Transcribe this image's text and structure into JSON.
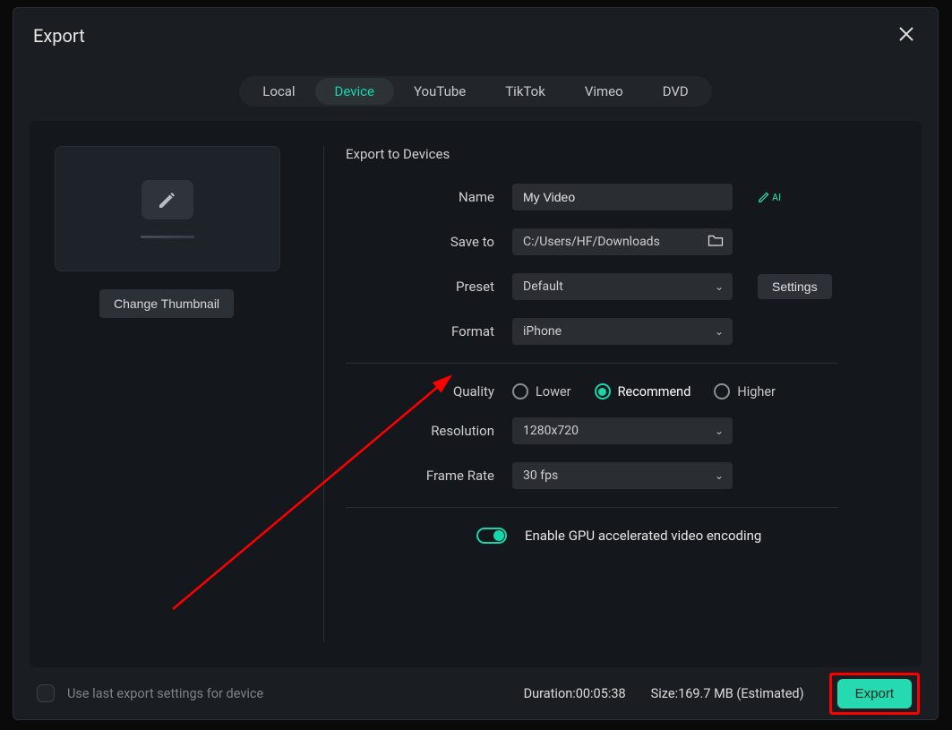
{
  "title": "Export",
  "tabs": [
    {
      "label": "Local"
    },
    {
      "label": "Device"
    },
    {
      "label": "YouTube"
    },
    {
      "label": "TikTok"
    },
    {
      "label": "Vimeo"
    },
    {
      "label": "DVD"
    }
  ],
  "active_tab": "Device",
  "change_thumbnail": "Change Thumbnail",
  "section_title": "Export to Devices",
  "labels": {
    "name": "Name",
    "save_to": "Save to",
    "preset": "Preset",
    "format": "Format",
    "quality": "Quality",
    "resolution": "Resolution",
    "frame_rate": "Frame Rate"
  },
  "values": {
    "name": "My Video",
    "save_to": "C:/Users/HF/Downloads",
    "preset": "Default",
    "format": "iPhone",
    "resolution": "1280x720",
    "frame_rate": "30 fps"
  },
  "ai_label": "AI",
  "settings_btn": "Settings",
  "quality_options": {
    "lower": "Lower",
    "recommend": "Recommend",
    "higher": "Higher"
  },
  "toggle_label": "Enable GPU accelerated video encoding",
  "footer": {
    "checkbox_label": "Use last export settings for device",
    "duration_label": "Duration:",
    "duration_value": "00:05:38",
    "size_label": "Size:",
    "size_value": "169.7 MB",
    "size_suffix": "(Estimated)",
    "export": "Export"
  }
}
